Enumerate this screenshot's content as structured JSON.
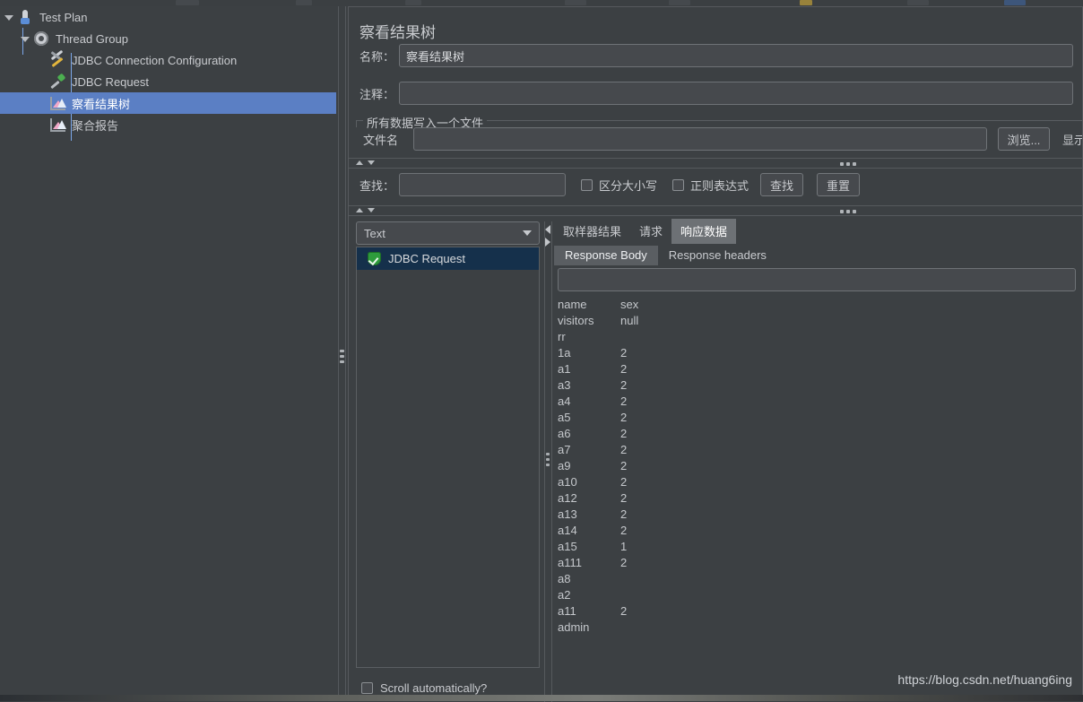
{
  "tree": {
    "items": [
      {
        "label": "Test Plan",
        "icon": "test-plan-icon",
        "depth": 0,
        "selected": false,
        "twisty": true
      },
      {
        "label": "Thread Group",
        "icon": "gear-icon",
        "depth": 1,
        "selected": false,
        "twisty": true
      },
      {
        "label": "JDBC Connection Configuration",
        "icon": "wrench-screwdriver-icon",
        "depth": 2,
        "selected": false,
        "twisty": false
      },
      {
        "label": "JDBC Request",
        "icon": "pipette-icon",
        "depth": 2,
        "selected": false,
        "twisty": false
      },
      {
        "label": "察看结果树",
        "icon": "chart-icon",
        "depth": 2,
        "selected": true,
        "twisty": false
      },
      {
        "label": "聚合报告",
        "icon": "chart-icon",
        "depth": 2,
        "selected": false,
        "twisty": false
      }
    ]
  },
  "panel": {
    "title": "察看结果树",
    "name_label": "名称：",
    "name_value": "察看结果树",
    "comment_label": "注释：",
    "comment_value": "",
    "group_label": "所有数据写入一个文件",
    "filename_label": "文件名",
    "filename_value": "",
    "browse_button": "浏览...",
    "show_log_label": "显示日志"
  },
  "search": {
    "label": "查找：",
    "value": "",
    "case_sensitive_label": "区分大小写",
    "case_sensitive_checked": false,
    "regex_label": "正则表达式",
    "regex_checked": false,
    "find_button": "查找",
    "reset_button": "重置"
  },
  "results": {
    "render_selected": "Text",
    "render_options": [
      "Text"
    ],
    "items": [
      {
        "label": "JDBC Request",
        "icon": "shield-check-icon",
        "selected": true
      }
    ],
    "scroll_auto_label": "Scroll automatically?",
    "scroll_auto_checked": false
  },
  "tabs": {
    "main": [
      {
        "label": "取样器结果",
        "selected": false
      },
      {
        "label": "请求",
        "selected": false
      },
      {
        "label": "响应数据",
        "selected": true
      }
    ],
    "sub": [
      {
        "label": "Response Body",
        "selected": true
      },
      {
        "label": "Response headers",
        "selected": false
      }
    ]
  },
  "response": {
    "filter_value": "",
    "columns": [
      "name",
      "sex"
    ],
    "rows": [
      {
        "name": "name",
        "sex": "sex"
      },
      {
        "name": "visitors",
        "sex": "null"
      },
      {
        "name": "rr",
        "sex": ""
      },
      {
        "name": "1a",
        "sex": "2"
      },
      {
        "name": "a1",
        "sex": "2"
      },
      {
        "name": "a3",
        "sex": "2"
      },
      {
        "name": "a4",
        "sex": "2"
      },
      {
        "name": "a5",
        "sex": "2"
      },
      {
        "name": "a6",
        "sex": "2"
      },
      {
        "name": "a7",
        "sex": "2"
      },
      {
        "name": "a9",
        "sex": "2"
      },
      {
        "name": "a10",
        "sex": "2"
      },
      {
        "name": "a12",
        "sex": "2"
      },
      {
        "name": "a13",
        "sex": "2"
      },
      {
        "name": "a14",
        "sex": "2"
      },
      {
        "name": "a15",
        "sex": "1"
      },
      {
        "name": "a111",
        "sex": "2"
      },
      {
        "name": "a8",
        "sex": ""
      },
      {
        "name": "a2",
        "sex": ""
      },
      {
        "name": "a11",
        "sex": "2"
      },
      {
        "name": "admin",
        "sex": ""
      }
    ]
  },
  "watermark": "https://blog.csdn.net/huang6ing",
  "colors": {
    "background": "#3c4043",
    "selection_blue": "#5b7fc4",
    "list_selection": "#15304b",
    "tab_selected": "#6d7175",
    "border": "#5a5e62"
  }
}
